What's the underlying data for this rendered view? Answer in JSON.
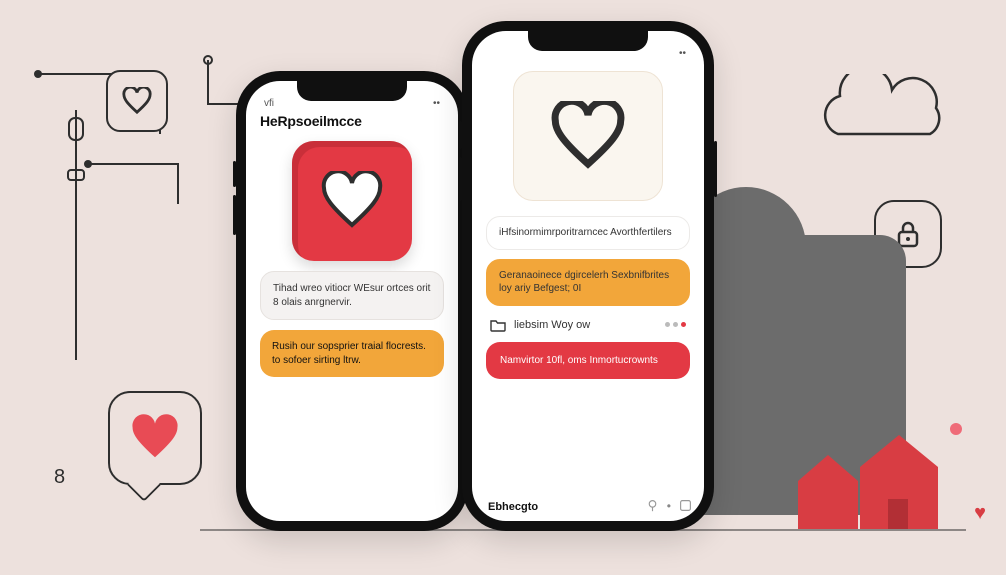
{
  "colors": {
    "accent_red": "#e33944",
    "accent_orange": "#f2a63a",
    "ink": "#2e2e2e",
    "bg": "#ede1dd"
  },
  "decor": {
    "bottom_left_digit": "8"
  },
  "phone_left": {
    "status_left": "vfi",
    "header_title": "HeRpsoeilmcce",
    "card_grey": "Tihad wreo vitiocr WEsur ortces orit 8 olais anrgnervir.",
    "card_orange": "Rusih our sopsprier traial flocrests. to sofoer sirting ltrw."
  },
  "phone_right": {
    "list1": "iHfsinormimrporitrarncec Avorthfertilers",
    "list2": "Geranaoinece dgircelerh Sexbnifbrites loy ariy Befgest;   0I",
    "row_icon_label": "liebsim Woy ow",
    "card_red": "Namvirtor 10fl, oms Inmortucrownts",
    "bottom_label": "Ebhecgto"
  }
}
